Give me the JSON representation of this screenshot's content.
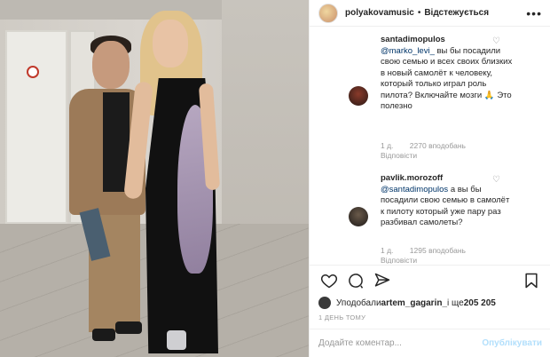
{
  "header": {
    "username": "polyakovamusic",
    "separator": "•",
    "follow_label": "Відстежується",
    "more": "•••"
  },
  "comments": [
    {
      "username": "santadimopulos",
      "mention": "@marko_levi_",
      "text": " вы бы посадили свою семью и всех своих близких в новый самолёт к человеку, который только играл роль пилота? Включайте мозги 🙏 Это полезно",
      "time": "1 д.",
      "likes": "2270 вподобань",
      "reply": "Відповісти"
    },
    {
      "username": "pavlik.morozoff",
      "mention": "@santadimopulos",
      "text": " а вы бы посадили свою семью в самолёт к пилоту который уже пару раз разбивал самолеты?",
      "time": "1 д.",
      "likes": "1295 вподобань",
      "reply": "Відповісти"
    }
  ],
  "likes_line": {
    "prefix": "Уподобали ",
    "user": "artem_gagarin_",
    "middle": " і ще ",
    "count": "205 205"
  },
  "time_ago": "1 ДЕНЬ ТОМУ",
  "add_comment": {
    "placeholder": "Додайте коментар...",
    "publish": "Опублікувати"
  },
  "icons": [
    "heart-icon",
    "comment-icon",
    "share-icon",
    "bookmark-icon"
  ]
}
